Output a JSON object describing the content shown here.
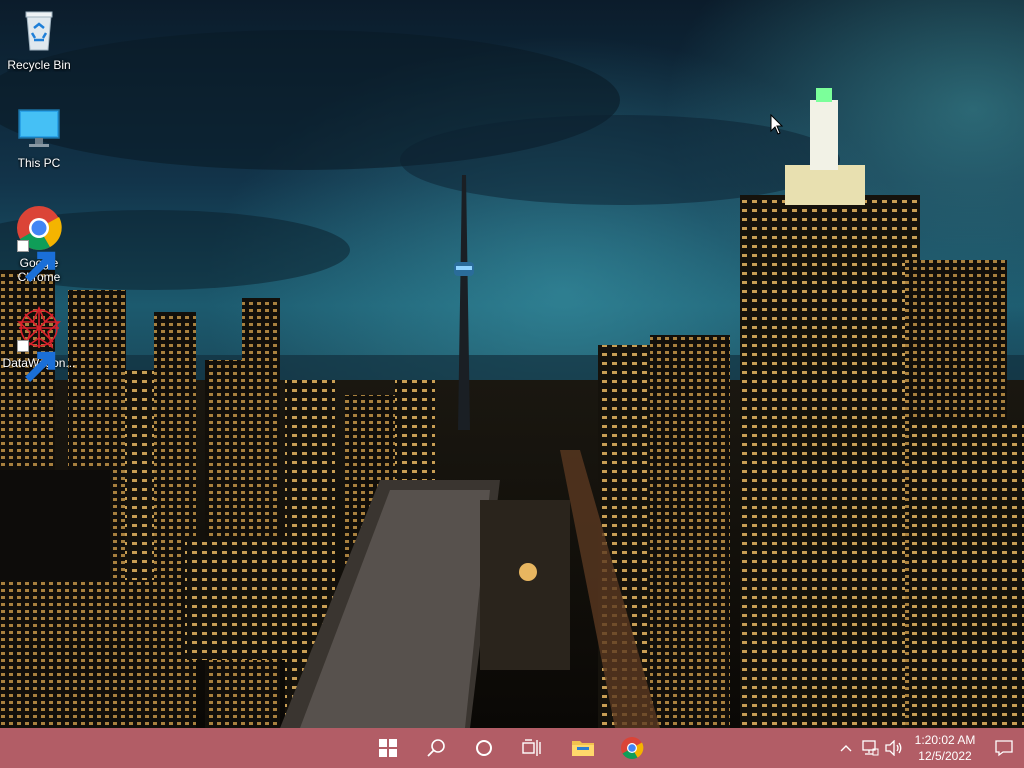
{
  "desktop": {
    "icons": [
      {
        "label": "Recycle Bin",
        "icon": "recycle-bin-icon"
      },
      {
        "label": "This PC",
        "icon": "monitor-icon"
      },
      {
        "label": "Google Chrome",
        "icon": "chrome-icon"
      },
      {
        "label": "DataWagon...",
        "icon": "datawagon-icon"
      }
    ]
  },
  "taskbar": {
    "color": "#b25d66",
    "items": [
      {
        "name": "start",
        "icon": "windows-logo-icon"
      },
      {
        "name": "search",
        "icon": "search-icon"
      },
      {
        "name": "cortana",
        "icon": "cortana-circle-icon"
      },
      {
        "name": "task-view",
        "icon": "task-view-icon"
      },
      {
        "name": "file-explorer",
        "icon": "folder-icon"
      },
      {
        "name": "chrome",
        "icon": "chrome-icon"
      }
    ],
    "tray": {
      "icons": [
        "chevron-up-icon",
        "network-icon",
        "volume-icon"
      ],
      "time": "1:20:02 AM",
      "date": "12/5/2022",
      "notification_icon": "notification-icon"
    }
  }
}
